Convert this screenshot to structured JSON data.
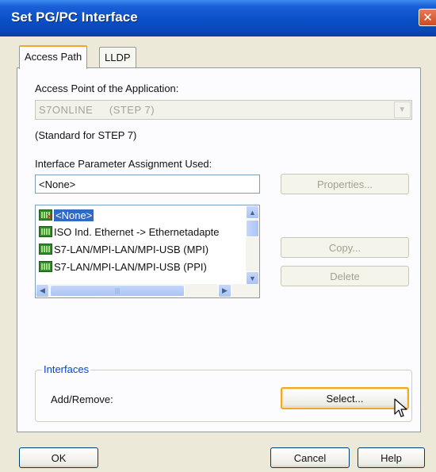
{
  "window": {
    "title": "Set PG/PC Interface"
  },
  "tabs": [
    {
      "label": "Access Path"
    },
    {
      "label": "LLDP"
    }
  ],
  "access_point": {
    "label": "Access Point of the Application:",
    "value": "S7ONLINE     (STEP 7)",
    "note": "(Standard for STEP 7)"
  },
  "assignment": {
    "label": "Interface Parameter Assignment Used:",
    "value": "<None>",
    "items": [
      {
        "label": "<None>",
        "icon": "interface-none-icon",
        "selected": true
      },
      {
        "label": "ISO Ind. Ethernet -> Ethernetadapte",
        "icon": "interface-card-icon"
      },
      {
        "label": "S7-LAN/MPI-LAN/MPI-USB (MPI)",
        "icon": "interface-card-icon"
      },
      {
        "label": "S7-LAN/MPI-LAN/MPI-USB (PPI)",
        "icon": "interface-card-icon"
      }
    ]
  },
  "side_buttons": {
    "properties": "Properties...",
    "copy": "Copy...",
    "delete": "Delete"
  },
  "interfaces": {
    "legend": "Interfaces",
    "label": "Add/Remove:",
    "select": "Select..."
  },
  "footer": {
    "ok": "OK",
    "cancel": "Cancel",
    "help": "Help"
  },
  "colors": {
    "titlebar": "#0b4fc8",
    "selection": "#316ac5",
    "focus": "#f5a623",
    "group_legend": "#0046d5"
  }
}
